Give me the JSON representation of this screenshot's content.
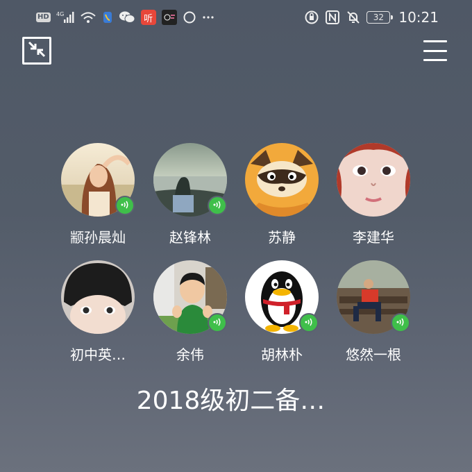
{
  "status_bar": {
    "hd": "HD",
    "network": "4G",
    "app_ting_label": "听",
    "time": "10:21",
    "battery": "32",
    "icons": [
      "hd-icon",
      "signal-4g-icon",
      "wifi-icon",
      "phone-app-icon",
      "wechat-icon",
      "ting-app-icon",
      "app-icon",
      "loading-circle-icon",
      "more-dots-icon",
      "rotate-lock-icon",
      "nfc-icon",
      "mute-bell-icon",
      "battery-icon"
    ]
  },
  "toolbar": {
    "minimize_icon": "minimize-icon",
    "menu_icon": "menu-icon"
  },
  "members": [
    {
      "name": "颛孙晨灿",
      "speaking": true
    },
    {
      "name": "赵锋林",
      "speaking": true
    },
    {
      "name": "苏静",
      "speaking": false
    },
    {
      "name": "李建华",
      "speaking": false
    },
    {
      "name": "初中英…",
      "speaking": false
    },
    {
      "name": "余伟",
      "speaking": true
    },
    {
      "name": "胡林朴",
      "speaking": true
    },
    {
      "name": "悠然一根",
      "speaking": true
    }
  ],
  "group": {
    "title": "2018级初二备…"
  },
  "colors": {
    "speaking_badge": "#3fbf4a",
    "background": "#535c69"
  }
}
